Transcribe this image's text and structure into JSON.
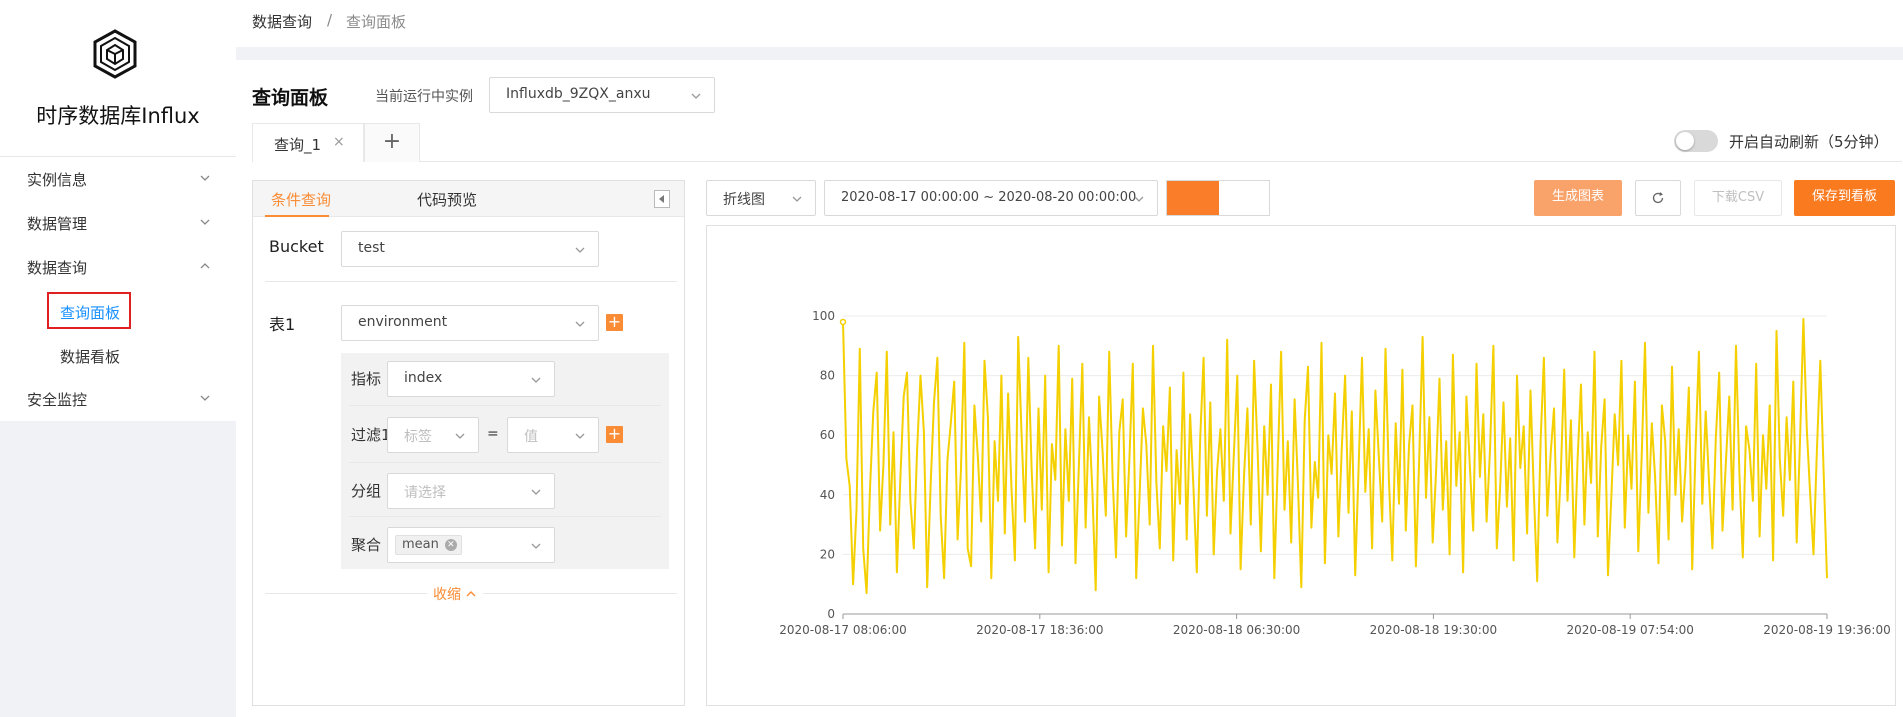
{
  "app": {
    "title": "时序数据库Influx"
  },
  "sidebar": {
    "items": [
      {
        "label": "实例信息",
        "expanded": false
      },
      {
        "label": "数据管理",
        "expanded": false
      },
      {
        "label": "数据查询",
        "expanded": true
      },
      {
        "label": "安全监控",
        "expanded": false
      }
    ],
    "subitems": [
      {
        "label": "查询面板",
        "active": true
      },
      {
        "label": "数据看板",
        "active": false
      }
    ]
  },
  "breadcrumb": {
    "parent": "数据查询",
    "separator": "/",
    "current": "查询面板"
  },
  "header": {
    "page_title": "查询面板",
    "instance_label": "当前运行中实例",
    "instance_value": "Influxdb_9ZQX_anxu"
  },
  "tabs": [
    {
      "label": "查询_1",
      "close": "×"
    }
  ],
  "tab_add": "+",
  "auto_refresh": {
    "label": "开启自动刷新（5分钟）",
    "on": false
  },
  "query": {
    "tabs": [
      "条件查询",
      "代码预览"
    ],
    "bucket_label": "Bucket",
    "bucket_value": "test",
    "table_label": "表1",
    "table_value": "environment",
    "metric_label": "指标",
    "metric_value": "index",
    "filter_label": "过滤1",
    "filter_tag_placeholder": "标签",
    "filter_eq": "=",
    "filter_value_placeholder": "值",
    "group_label": "分组",
    "group_placeholder": "请选择",
    "agg_label": "聚合",
    "agg_tag": "mean",
    "collapse_label": "收缩"
  },
  "toolbar": {
    "chart_type": "折线图",
    "time_range": "2020-08-17 00:00:00 ~ 2020-08-20 00:00:00",
    "color": "#fa7d2a",
    "generate": "生成图表",
    "download": "下载CSV",
    "save": "保存到看板"
  },
  "colors": {
    "accent": "#fa8c35",
    "link": "#1890ff",
    "series": "#f5d000"
  },
  "chart_data": {
    "type": "line",
    "x_ticks": [
      "2020-08-17 08:06:00",
      "2020-08-17 18:36:00",
      "2020-08-18 06:30:00",
      "2020-08-18 19:30:00",
      "2020-08-19 07:54:00",
      "2020-08-19 19:36:00"
    ],
    "y_ticks": [
      "0",
      "20",
      "40",
      "60",
      "80",
      "100"
    ],
    "ylim": [
      0,
      100
    ],
    "grid": true,
    "series": [
      {
        "color": "#f5d000",
        "values": [
          98,
          52,
          43,
          10,
          35,
          89,
          22,
          7,
          42,
          68,
          81,
          28,
          50,
          88,
          30,
          61,
          14,
          45,
          73,
          81,
          38,
          22,
          55,
          80,
          61,
          9,
          43,
          71,
          86,
          33,
          12,
          52,
          64,
          78,
          25,
          48,
          91,
          22,
          16,
          70,
          53,
          31,
          85,
          66,
          12,
          58,
          38,
          80,
          27,
          74,
          42,
          18,
          93,
          60,
          31,
          86,
          48,
          22,
          69,
          35,
          80,
          14,
          57,
          45,
          90,
          23,
          62,
          38,
          79,
          17,
          50,
          84,
          29,
          66,
          41,
          8,
          73,
          55,
          33,
          88,
          46,
          19,
          61,
          72,
          26,
          52,
          84,
          12,
          39,
          69,
          57,
          30,
          90,
          44,
          22,
          63,
          48,
          76,
          18,
          55,
          37,
          81,
          25,
          67,
          42,
          14,
          59,
          86,
          33,
          71,
          20,
          48,
          62,
          38,
          92,
          27,
          54,
          80,
          15,
          46,
          69,
          30,
          85,
          56,
          21,
          63,
          40,
          77,
          12,
          50,
          88,
          35,
          58,
          24,
          72,
          44,
          9,
          65,
          83,
          29,
          51,
          39,
          91,
          17,
          60,
          47,
          74,
          26,
          55,
          80,
          34,
          68,
          13,
          49,
          86,
          41,
          62,
          22,
          75,
          53,
          31,
          89,
          45,
          18,
          64,
          37,
          82,
          28,
          57,
          70,
          16,
          52,
          93,
          39,
          66,
          24,
          48,
          79,
          35,
          58,
          20,
          87,
          43,
          61,
          14,
          73,
          50,
          28,
          84,
          46,
          67,
          31,
          55,
          90,
          22,
          42,
          71,
          36,
          59,
          18,
          80,
          49,
          63,
          27,
          75,
          41,
          11,
          58,
          86,
          33,
          54,
          69,
          24,
          47,
          82,
          38,
          65,
          19,
          52,
          77,
          30,
          61,
          44,
          88,
          26,
          56,
          72,
          13,
          39,
          67,
          50,
          85,
          29,
          60,
          42,
          78,
          21,
          53,
          91,
          34,
          64,
          46,
          17,
          70,
          58,
          25,
          83,
          40,
          62,
          31,
          49,
          76,
          15,
          56,
          88,
          37,
          68,
          44,
          22,
          59,
          81,
          28,
          51,
          73,
          35,
          90,
          47,
          19,
          63,
          55,
          38,
          84,
          26,
          60,
          42,
          70,
          18,
          95,
          52,
          33,
          66,
          45,
          78,
          24,
          58,
          99,
          62,
          40,
          20,
          55,
          85,
          48,
          12
        ]
      }
    ]
  }
}
